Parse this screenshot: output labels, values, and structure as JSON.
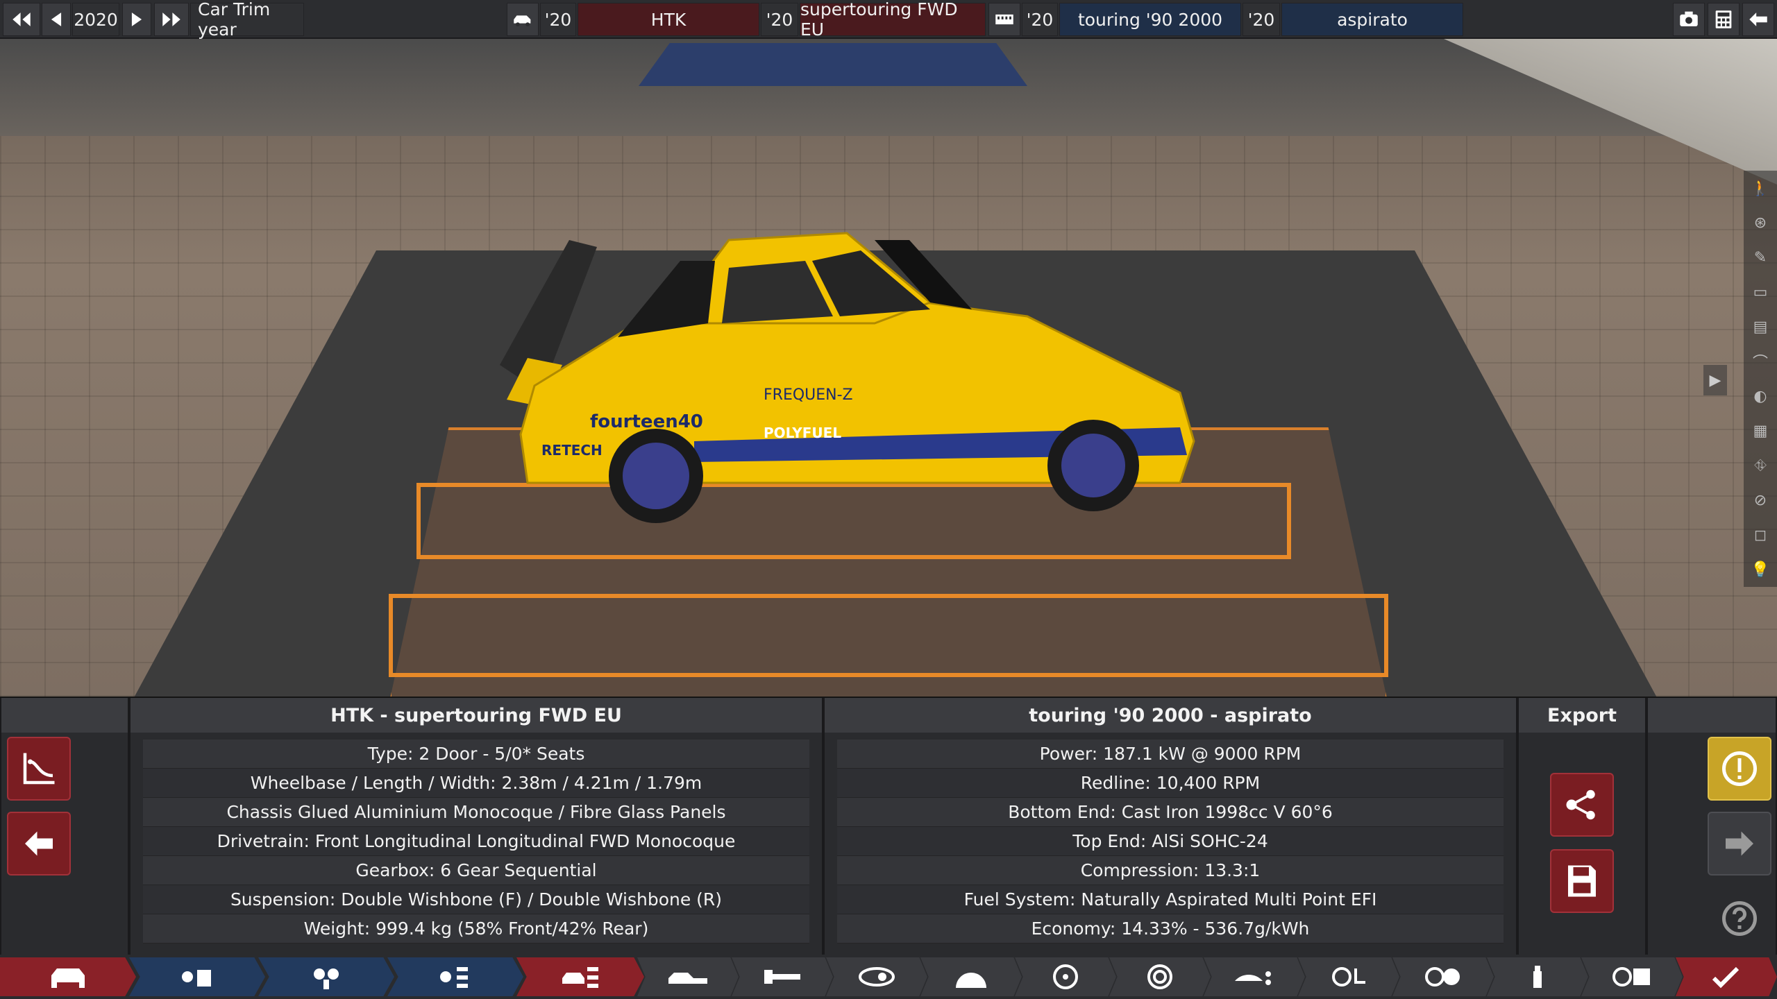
{
  "topbar": {
    "year": "2020",
    "car_trim_year_label": "Car Trim year",
    "body_year": "'20",
    "model_name": "HTK",
    "trim_year": "'20",
    "trim_name": "supertouring FWD EU",
    "engine_family_year": "'20",
    "engine_family_name": "touring '90 2000",
    "variant_year": "'20",
    "variant_name": "aspirato"
  },
  "left_summary": {
    "title": "HTK - supertouring FWD EU",
    "rows": [
      "Type: 2 Door - 5/0* Seats",
      "Wheelbase / Length / Width: 2.38m / 4.21m / 1.79m",
      "Chassis Glued Aluminium Monocoque / Fibre Glass Panels",
      "Drivetrain: Front Longitudinal Longitudinal FWD Monocoque",
      "Gearbox: 6 Gear Sequential",
      "Suspension: Double Wishbone (F) / Double Wishbone (R)",
      "Weight: 999.4 kg (58% Front/42% Rear)"
    ]
  },
  "right_summary": {
    "title": "touring '90 2000 - aspirato",
    "rows": [
      "Power: 187.1 kW @ 9000 RPM",
      "Redline:  10,400 RPM",
      "Bottom End: Cast Iron 1998cc V 60°6",
      "Top End: AlSi SOHC-24",
      "Compression: 13.3:1",
      "Fuel System: Naturally Aspirated Multi Point EFI",
      "Economy: 14.33% - 536.7g/kWh"
    ]
  },
  "export": {
    "title": "Export"
  },
  "car_livery": {
    "sponsor1": "fourteen40",
    "sponsor2": "FREQUEN-Z",
    "sponsor3": "POLYFUEL",
    "sponsor4": "RETECH"
  },
  "colors": {
    "accent_red": "#8a2128",
    "accent_blue": "#223a5e",
    "warning_gold": "#c8a427",
    "car_yellow": "#f2c200"
  }
}
